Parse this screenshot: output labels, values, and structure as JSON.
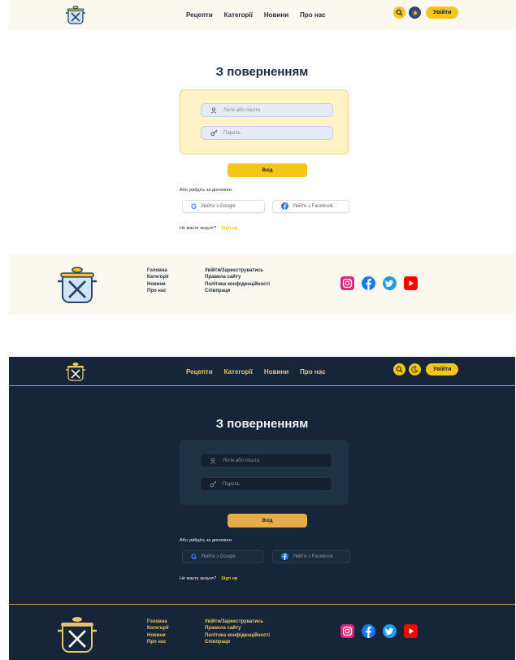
{
  "nav": [
    "Рецепти",
    "Категорії",
    "Новини",
    "Про нас"
  ],
  "login_button": "Увійти",
  "heading": "З поверненням",
  "login_placeholder": "Логін або пошта",
  "password_placeholder": "Пароль",
  "submit_label": "Вхід",
  "or_label": "Або увійдіть за допомоги",
  "google_label": "Увійти з Google",
  "facebook_label": "Увійти з Facebook",
  "no_account": "Не маєте акаунт?",
  "signup_label": "Sign up",
  "footer_col1": [
    "Головна",
    "Категорії",
    "Новини",
    "Про нас"
  ],
  "footer_col2": [
    "Увійти/Зареєструватись",
    "Правила сайту",
    "Політика конфіденційності",
    "Співпраця"
  ],
  "icons": {
    "logo": "pot-with-cutlery-icon",
    "search": "search-icon",
    "theme_light": "sun-icon",
    "theme_dark": "moon-icon",
    "user": "user-icon",
    "key": "key-icon",
    "social": [
      "instagram-icon",
      "facebook-icon",
      "twitter-icon",
      "youtube-icon"
    ]
  },
  "colors": {
    "accent": "#f5c518",
    "light_text": "#1c2b42",
    "dark_bg": "#172538",
    "dark_accent": "#e8c46a"
  }
}
